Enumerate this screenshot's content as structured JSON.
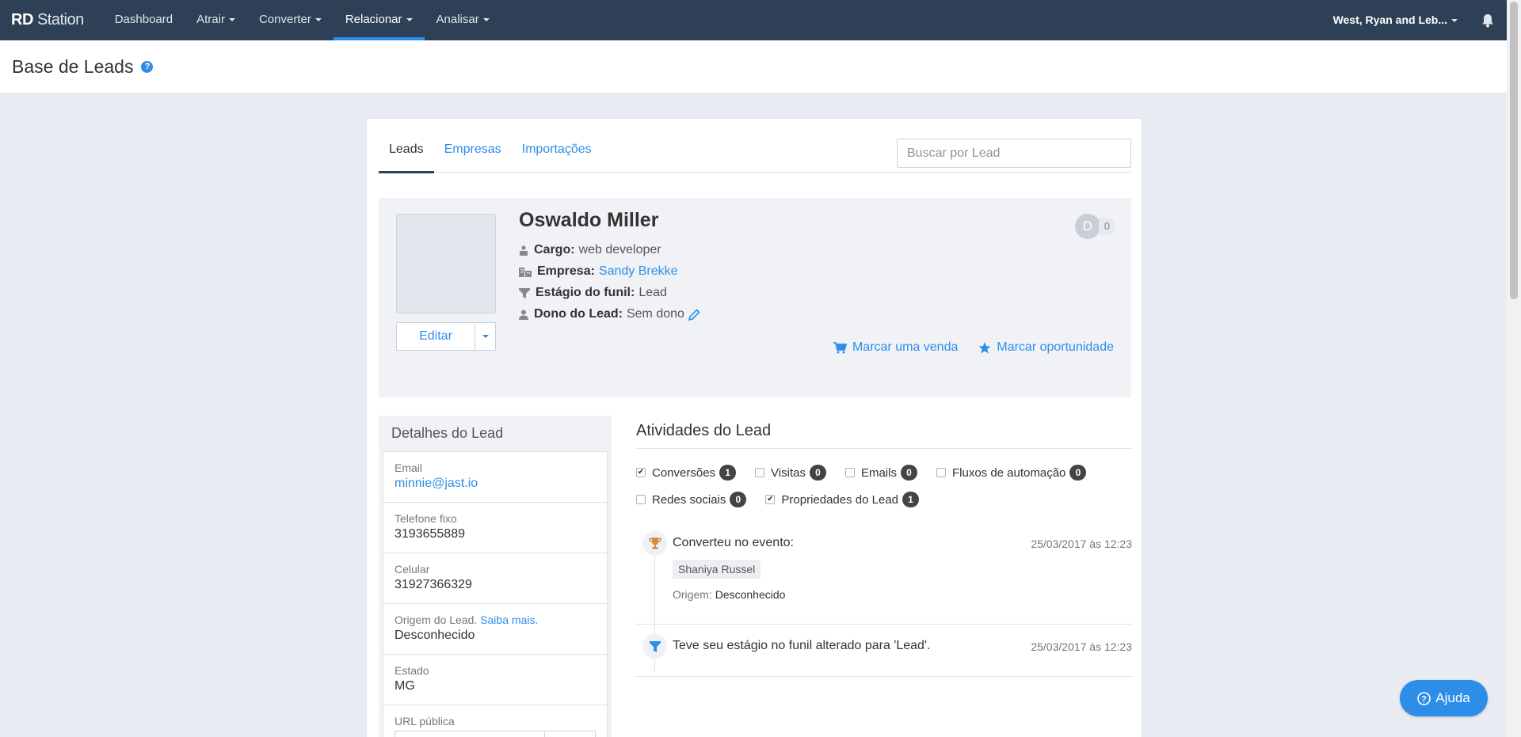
{
  "topnav": {
    "logo_bold": "RD",
    "logo_rest": " Station",
    "items": [
      {
        "label": "Dashboard"
      },
      {
        "label": "Atrair"
      },
      {
        "label": "Converter"
      },
      {
        "label": "Relacionar"
      },
      {
        "label": "Analisar"
      }
    ],
    "account": "West, Ryan and Leb..."
  },
  "page": {
    "title": "Base de Leads",
    "help": "?"
  },
  "tabs": [
    {
      "label": "Leads"
    },
    {
      "label": "Empresas"
    },
    {
      "label": "Importações"
    }
  ],
  "search": {
    "placeholder": "Buscar por Lead"
  },
  "lead": {
    "name": "Oswaldo Miller",
    "cargo_label": "Cargo:",
    "cargo": "web developer",
    "empresa_label": "Empresa:",
    "empresa": "Sandy Brekke",
    "estagio_label": "Estágio do funil:",
    "estagio": "Lead",
    "dono_label": "Dono do Lead:",
    "dono": "Sem dono",
    "score_letter": "D",
    "score_value": "0",
    "edit_label": "Editar",
    "venda_label": "Marcar uma venda",
    "oportunidade_label": "Marcar oportunidade"
  },
  "details": {
    "title": "Detalhes do Lead",
    "email_label": "Email",
    "email": "minnie@jast.io",
    "telefone_label": "Telefone fixo",
    "telefone": "3193655889",
    "celular_label": "Celular",
    "celular": "31927366329",
    "origem_label": "Origem do Lead.",
    "origem_link": "Saiba mais.",
    "origem": "Desconhecido",
    "estado_label": "Estado",
    "estado": "MG",
    "url_label": "URL pública"
  },
  "activities": {
    "title": "Atividades do Lead",
    "filters": [
      {
        "label": "Conversões",
        "count": "1",
        "checked": true
      },
      {
        "label": "Visitas",
        "count": "0",
        "checked": false
      },
      {
        "label": "Emails",
        "count": "0",
        "checked": false
      },
      {
        "label": "Fluxos de automação",
        "count": "0",
        "checked": false
      },
      {
        "label": "Redes sociais",
        "count": "0",
        "checked": false
      },
      {
        "label": "Propriedades do Lead",
        "count": "1",
        "checked": true
      }
    ],
    "events": [
      {
        "title": "Converteu no evento:",
        "date": "25/03/2017 às 12:23",
        "tag": "Shaniya Russel",
        "origem_label": "Origem:",
        "origem": "Desconhecido"
      },
      {
        "title": "Teve seu estágio no funil alterado para 'Lead'.",
        "date": "25/03/2017 às 12:23"
      }
    ]
  },
  "ajuda": "Ajuda",
  "colors": {
    "nav": "#2d4055",
    "accent": "#2d8ee9"
  }
}
